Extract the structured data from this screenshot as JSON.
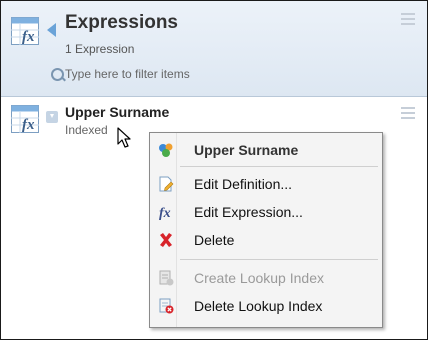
{
  "header": {
    "title": "Expressions",
    "count": "1 Expression",
    "filter_placeholder": "Type here to filter items"
  },
  "item": {
    "name": "Upper Surname",
    "subtitle": "Indexed"
  },
  "context_menu": {
    "title": "Upper Surname",
    "items": [
      {
        "label": "Edit Definition...",
        "icon": "edit-definition-icon",
        "enabled": true
      },
      {
        "label": "Edit Expression...",
        "icon": "fx-icon",
        "enabled": true
      },
      {
        "label": "Delete",
        "icon": "delete-x-icon",
        "enabled": true
      },
      {
        "label": "Create Lookup Index",
        "icon": "create-index-icon",
        "enabled": false
      },
      {
        "label": "Delete Lookup Index",
        "icon": "delete-index-icon",
        "enabled": true
      }
    ]
  },
  "colors": {
    "header_bg": "#dde7f2",
    "accent_blue": "#6aa3d8",
    "delete_red": "#d8232a",
    "menu_bg": "#f4f4f4"
  }
}
